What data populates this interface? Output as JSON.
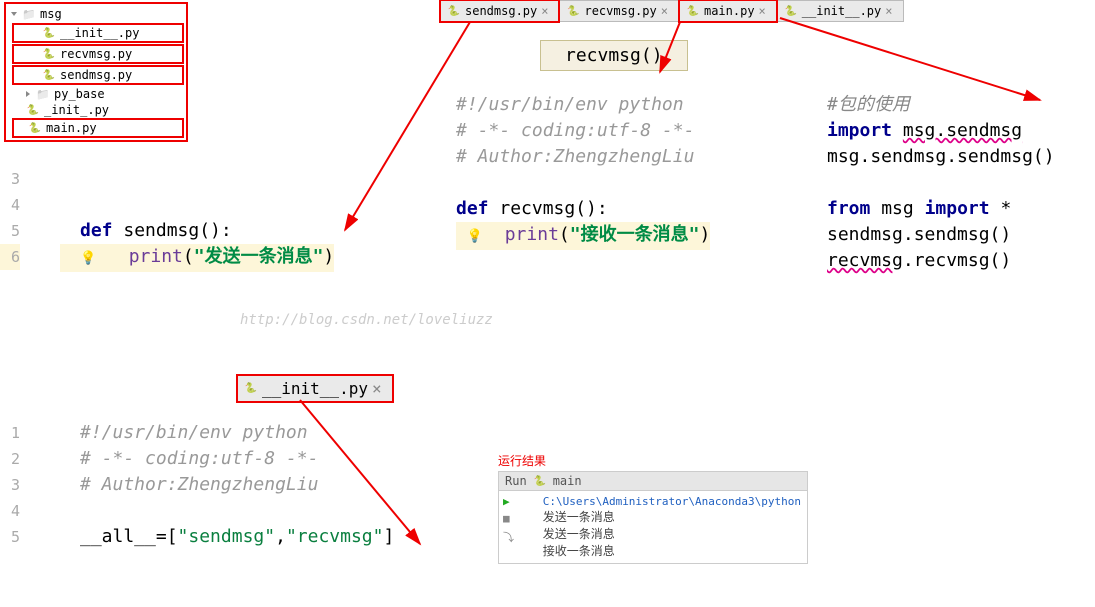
{
  "tree": {
    "folder1": "msg",
    "f1a": "__init__.py",
    "f1b": "recvmsg.py",
    "f1c": "sendmsg.py",
    "folder2": "py_base",
    "f2a": "_init_.py",
    "f2b": "main.py"
  },
  "tabs": {
    "sendmsg": "sendmsg.py",
    "recvmsg": "recvmsg.py",
    "main": "main.py",
    "init": "__init__.py"
  },
  "tooltip": "recvmsg()",
  "sendmsg_code": {
    "ln3": "3",
    "ln4": "4",
    "ln5": "5",
    "ln6": "6",
    "def": "def",
    "name": "sendmsg",
    "paren": "(): ",
    "print": "print",
    "open": "(",
    "str": "\"发送一条消息\"",
    "close": ")"
  },
  "recvmsg_code": {
    "c1": "#!/usr/bin/env python",
    "c2": "# -*- coding:utf-8 -*-",
    "c3": "# Author:ZhengzhengLiu",
    "def": "def",
    "name": "recvmsg",
    "paren": "(): ",
    "print": "print",
    "open": "(",
    "str": "\"接收一条消息\"",
    "close": ")"
  },
  "main_code": {
    "c0": "#包的使用",
    "imp": "import",
    "m1": "msg.sendmsg",
    "l2": "msg.sendmsg.sendmsg()",
    "from": "from",
    "msg": "msg",
    "imp2": "import",
    "star": "*",
    "l4": "sendmsg.sendmsg()",
    "l5": "recvmsg.recvmsg()",
    "recvm": "recvmsg"
  },
  "init_code": {
    "ln1": "1",
    "ln2": "2",
    "ln3": "3",
    "ln4": "4",
    "ln5": "5",
    "c1": "#!/usr/bin/env python",
    "c2": "# -*- coding:utf-8 -*-",
    "c3": "# Author:ZhengzhengLiu",
    "var": "__all__",
    "eq": "=[",
    "s1": "\"sendmsg\"",
    "comma": ",",
    "s2": "\"recvmsg\"",
    "close": "]"
  },
  "run": {
    "title": "运行结果",
    "head": "Run",
    "app": "main",
    "path": "C:\\Users\\Administrator\\Anaconda3\\python",
    "o1": "发送一条消息",
    "o2": "发送一条消息",
    "o3": "接收一条消息"
  },
  "watermark": "http://blog.csdn.net/loveliuzz",
  "init_tab_label": "__init__.py"
}
